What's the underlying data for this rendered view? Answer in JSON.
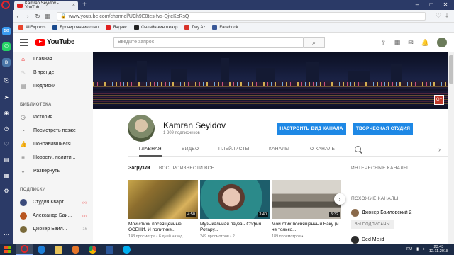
{
  "browser": {
    "tab_title": "Kamran Seyidov - YouTub",
    "new_tab": "+",
    "url": "www.youtube.com/channel/UCh9E0tes-fvs-QjteKcRsQ",
    "window_controls": [
      "–",
      "□",
      "✕"
    ],
    "bookmarks": [
      {
        "label": "AliExpress",
        "color": "#e8442c"
      },
      {
        "label": "Бронирование отел",
        "color": "#1a4a8e"
      },
      {
        "label": "Яндекс",
        "color": "#e02020"
      },
      {
        "label": "Онлайн-кинотеатр",
        "color": "#222222"
      },
      {
        "label": "Day.Az",
        "color": "#d8332a"
      },
      {
        "label": "Facebook",
        "color": "#3b5998"
      }
    ]
  },
  "youtube": {
    "logo_text": "YouTube",
    "search_placeholder": "Введите запрос",
    "nav": {
      "main": [
        {
          "label": "Главная",
          "icon": "home-icon",
          "glyph": "⌂",
          "active": true
        },
        {
          "label": "В тренде",
          "icon": "trending-icon",
          "glyph": "♨",
          "active": false
        },
        {
          "label": "Подписки",
          "icon": "subscriptions-icon",
          "glyph": "▤",
          "active": false
        }
      ],
      "library_heading": "БИБЛИОТЕКА",
      "library": [
        {
          "label": "История",
          "icon": "history-icon",
          "glyph": "◷"
        },
        {
          "label": "Посмотреть позже",
          "icon": "watch-later-icon",
          "glyph": "◔"
        },
        {
          "label": "Понравившиеся...",
          "icon": "like-icon",
          "glyph": "👍"
        },
        {
          "label": "Новости, полити...",
          "icon": "playlist-icon",
          "glyph": "≡"
        },
        {
          "label": "Развернуть",
          "icon": "chevron-down-icon",
          "glyph": "⌄"
        }
      ],
      "subs_heading": "ПОДПИСКИ",
      "subscriptions": [
        {
          "label": "Студия Кварт...",
          "color": "#3a4a7a",
          "badge": "live"
        },
        {
          "label": "Александр Баи...",
          "color": "#b8551f",
          "badge": "live"
        },
        {
          "label": "Джокер Баил...",
          "color": "#7a6a3a",
          "badge": "16"
        }
      ]
    },
    "channel": {
      "name": "Kamran Seyidov",
      "subscribers": "1 309 подписчиков",
      "btn_customize": "НАСТРОИТЬ ВИД КАНАЛА",
      "btn_studio": "ТВОРЧЕСКАЯ СТУДИЯ",
      "tabs": [
        "ГЛАВНАЯ",
        "ВИДЕО",
        "ПЛЕЙЛИСТЫ",
        "КАНАЛЫ",
        "О КАНАЛЕ"
      ]
    },
    "uploads": {
      "title": "Загрузки",
      "play_all": "ВОСПРОИЗВЕСТИ ВСЕ",
      "videos": [
        {
          "title": "Мои стихи посвященные ОСЕНИ. И политике...",
          "meta": "143 просмотра • 6 дней назад",
          "duration": "4:50",
          "thumb": "linear-gradient(135deg,#c7a54a 0%,#8d6e2e 30%,#6b5a2a 55%,#d9b25c 75%,#7a5a22 100%)"
        },
        {
          "title": "Музыкальная пауза - София Ротару...",
          "meta": "249 просмотров • 2 ...",
          "duration": "3:40",
          "thumb": "radial-gradient(circle at 45% 45%,#e7c6b5 0 20%,#5c3a2f 21% 30%,#2b8a8a 31% 70%,#1d5e6b 71%)"
        },
        {
          "title": "Мои стих посвященный Баку (и не только...",
          "meta": "189 просмотров • ...",
          "duration": "5:32",
          "thumb": "linear-gradient(180deg,#d8d4cc 0 35%,#8c857a 36% 55%,#5a554c 56% 70%,#b8b2a8 71%)"
        }
      ]
    },
    "right_column": {
      "interesting": "ИНТЕРЕСНЫЕ КАНАЛЫ",
      "similar": "ПОХОЖИЕ КАНАЛЫ",
      "channels": [
        {
          "name": "Джокер Баиловский 2",
          "color": "#8a6a4a"
        },
        {
          "name": "Ded Mejid",
          "color": "#2b2b2b"
        }
      ],
      "subscribed": "ВЫ ПОДПИСАНЫ"
    }
  },
  "taskbar": {
    "lang": "RU",
    "time": "23:43",
    "date": "12.11.2018"
  }
}
